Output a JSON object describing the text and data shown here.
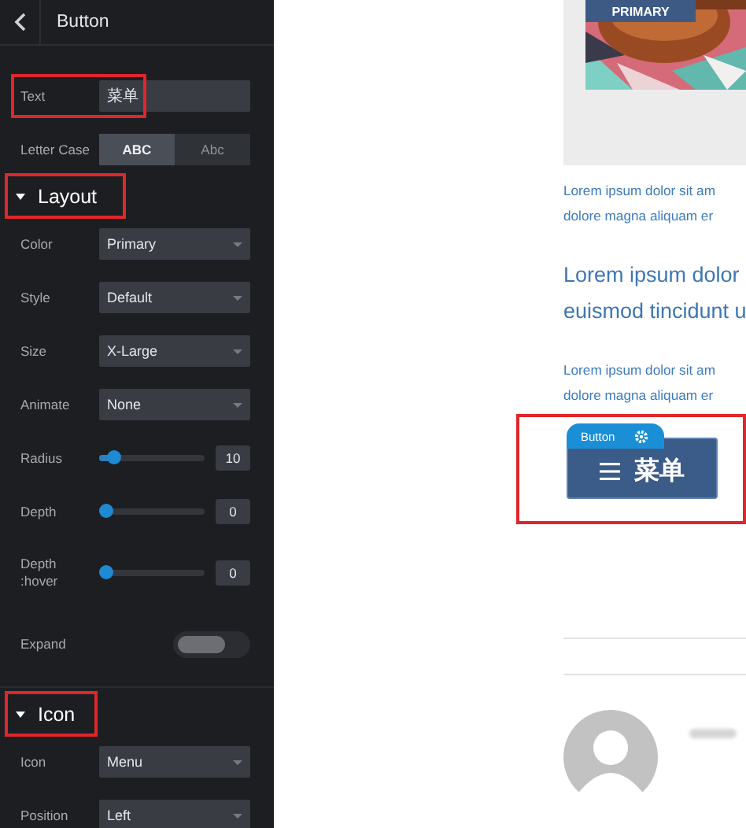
{
  "panel": {
    "title": "Button",
    "rows": [
      {
        "kind": "text",
        "label": "Text",
        "value": "菜单",
        "highlighted": true
      },
      {
        "kind": "segmented",
        "label": "Letter Case",
        "options": [
          {
            "label": "ABC",
            "selected": true
          },
          {
            "label": "Abc",
            "selected": false
          }
        ]
      },
      {
        "kind": "section",
        "label": "Layout",
        "expanded": true,
        "highlighted": true
      },
      {
        "kind": "select",
        "label": "Color",
        "value": "Primary"
      },
      {
        "kind": "select",
        "label": "Style",
        "value": "Default"
      },
      {
        "kind": "select",
        "label": "Size",
        "value": "X-Large"
      },
      {
        "kind": "select",
        "label": "Animate",
        "value": "None"
      },
      {
        "kind": "slider",
        "label": "Radius",
        "level": 0.13,
        "reading": "10"
      },
      {
        "kind": "slider",
        "label": "Depth",
        "level": 0,
        "reading": "0"
      },
      {
        "kind": "slider",
        "label": "Depth :hover",
        "level": 0,
        "reading": "0"
      },
      {
        "kind": "toggle",
        "label": "Expand",
        "on": false
      },
      {
        "kind": "section",
        "label": "Icon",
        "expanded": true,
        "highlighted": true
      },
      {
        "kind": "select",
        "label": "Icon",
        "value": "Menu"
      },
      {
        "kind": "select",
        "label": "Position",
        "value": "Left"
      }
    ]
  },
  "preview": {
    "image_badge": "PRIMARY",
    "blocks": [
      {
        "kind": "small",
        "lines": [
          "Lorem ipsum dolor sit am",
          "dolore magna aliquam er"
        ]
      },
      {
        "kind": "heading",
        "lines": [
          "Lorem ipsum dolor",
          "euismod tincidunt u"
        ]
      },
      {
        "kind": "small",
        "lines": [
          "Lorem ipsum dolor sit am",
          "dolore magna aliquam er"
        ]
      }
    ],
    "button": {
      "tag": "Button",
      "label": "菜单",
      "highlighted": true
    }
  }
}
